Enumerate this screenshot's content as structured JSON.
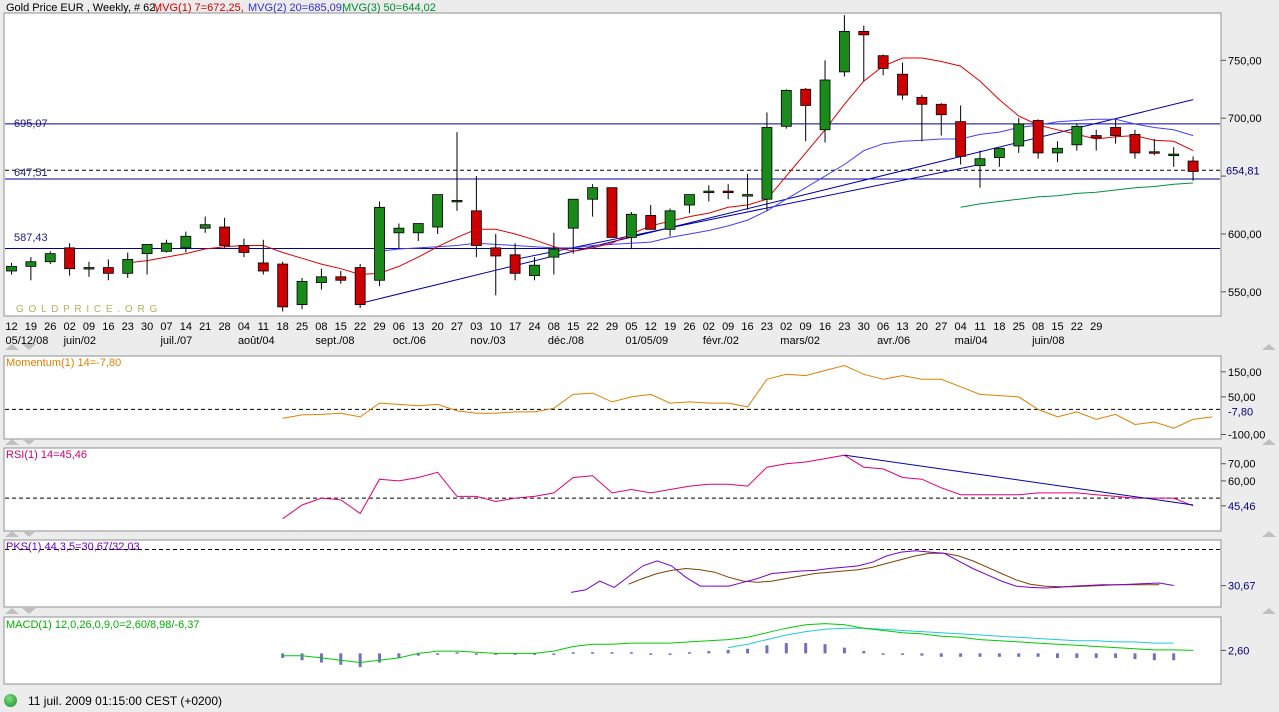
{
  "header": {
    "title": "Gold Price EUR , Weekly, # 62,",
    "mavg1": "MVG(1) 7=672,25,",
    "mavg2": "MVG(2) 20=685,09,",
    "mavg3": "MVG(3) 50=644,02"
  },
  "colors": {
    "up": "#1a8a1a",
    "down": "#cc0000",
    "ma1": "#e00000",
    "ma2": "#4040ff",
    "ma3": "#009040",
    "trend": "#0000b0",
    "momentum": "#e08000",
    "rsi": "#e0007a",
    "pks_k": "#7a00d0",
    "pks_d": "#804000",
    "macd": "#00cc00",
    "signal": "#20c8e0",
    "hist": "#7070c0"
  },
  "watermark": "G O L D P R I C E . O R G",
  "price_labels": {
    "l695": "695,07",
    "l647": "647,51",
    "l587": "587,43",
    "last": "654,81"
  },
  "date_ticks": [
    "12",
    "19",
    "26",
    "02",
    "09",
    "16",
    "23",
    "30",
    "07",
    "14",
    "21",
    "28",
    "04",
    "11",
    "18",
    "25",
    "08",
    "15",
    "22",
    "29",
    "06",
    "13",
    "20",
    "27",
    "03",
    "10",
    "17",
    "24",
    "08",
    "15",
    "22",
    "29",
    "05",
    "12",
    "19",
    "26",
    "02",
    "09",
    "16",
    "23",
    "02",
    "09",
    "16",
    "23",
    "30",
    "06",
    "13",
    "20",
    "27",
    "04",
    "11",
    "18",
    "25",
    "08",
    "15",
    "22",
    "29"
  ],
  "month_labels": [
    {
      "text": "05/12/08",
      "i": 0
    },
    {
      "text": "juin/02",
      "i": 3
    },
    {
      "text": "juil./07",
      "i": 8
    },
    {
      "text": "août/04",
      "i": 12
    },
    {
      "text": "sept./08",
      "i": 16
    },
    {
      "text": "oct./06",
      "i": 20
    },
    {
      "text": "nov./03",
      "i": 24
    },
    {
      "text": "déc./08",
      "i": 28
    },
    {
      "text": "01/05/09",
      "i": 32
    },
    {
      "text": "févr./02",
      "i": 36
    },
    {
      "text": "mars/02",
      "i": 40
    },
    {
      "text": "avr./06",
      "i": 45
    },
    {
      "text": "mai/04",
      "i": 49
    },
    {
      "text": "juin/08",
      "i": 53
    }
  ],
  "panels": {
    "momentum": {
      "label": "Momentum(1) 14=-7,80",
      "last": "-7,80"
    },
    "rsi": {
      "label": "RSI(1) 14=45,46",
      "last": "45,46"
    },
    "pks": {
      "label": "PKS(1) 44,3,5=30,67/32,03",
      "last": "30,67"
    },
    "macd": {
      "label": "MACD(1) 12,0,26,0,9,0=2,60/8,98/-6,37",
      "last": "2,60"
    }
  },
  "footer": {
    "datetime": "11 juil. 2009 01:15:00  CEST (+0200)"
  },
  "chart_data": [
    {
      "type": "candlestick",
      "title": "Gold Price EUR , Weekly, # 62,",
      "ylim": [
        530,
        790
      ],
      "y_ticks": [
        550,
        600,
        650,
        700,
        750
      ],
      "y_tick_labels": [
        "550,00",
        "600,00",
        "",
        "700,00",
        "750,00"
      ],
      "horizontal_lines": [
        695.07,
        647.51,
        587.43
      ],
      "dashed_line": 655,
      "last_value": 654.81,
      "candles": [
        [
          568,
          575,
          565,
          572
        ],
        [
          572,
          580,
          560,
          576
        ],
        [
          576,
          585,
          574,
          583
        ],
        [
          588,
          592,
          564,
          570
        ],
        [
          571,
          576,
          563,
          571
        ],
        [
          571,
          578,
          560,
          566
        ],
        [
          566,
          584,
          562,
          578
        ],
        [
          583,
          590,
          565,
          591
        ],
        [
          585,
          595,
          584,
          592
        ],
        [
          588,
          602,
          584,
          598
        ],
        [
          605,
          615,
          601,
          608
        ],
        [
          606,
          614,
          588,
          590
        ],
        [
          590,
          596,
          580,
          584
        ],
        [
          575,
          595,
          565,
          568
        ],
        [
          574,
          576,
          533,
          537
        ],
        [
          539,
          562,
          535,
          559
        ],
        [
          558,
          570,
          552,
          563
        ],
        [
          563,
          568,
          557,
          560
        ],
        [
          571,
          574,
          536,
          539
        ],
        [
          560,
          628,
          555,
          623
        ],
        [
          601,
          609,
          587,
          605
        ],
        [
          601,
          608,
          594,
          609
        ],
        [
          606,
          634,
          600,
          634
        ],
        [
          629,
          688,
          620,
          629
        ],
        [
          620,
          650,
          580,
          590
        ],
        [
          588,
          600,
          547,
          581
        ],
        [
          582,
          592,
          560,
          566
        ],
        [
          564,
          580,
          560,
          573
        ],
        [
          580,
          601,
          565,
          587
        ],
        [
          605,
          625,
          583,
          630
        ],
        [
          630,
          643,
          615,
          640
        ],
        [
          640,
          635,
          612,
          597
        ],
        [
          597,
          619,
          587,
          617
        ],
        [
          616,
          625,
          610,
          604
        ],
        [
          604,
          622,
          598,
          620
        ],
        [
          625,
          633,
          618,
          634
        ],
        [
          636,
          642,
          628,
          637
        ],
        [
          637,
          643,
          630,
          636
        ],
        [
          634,
          652,
          621,
          634
        ],
        [
          630,
          705,
          620,
          692
        ],
        [
          693,
          725,
          691,
          724
        ],
        [
          725,
          726,
          680,
          711
        ],
        [
          690,
          750,
          679,
          733
        ],
        [
          740,
          789,
          736,
          775
        ],
        [
          775,
          780,
          732,
          772
        ],
        [
          754,
          755,
          737,
          743
        ],
        [
          738,
          748,
          716,
          720
        ],
        [
          718,
          720,
          680,
          712
        ],
        [
          712,
          713,
          685,
          703
        ],
        [
          697,
          711,
          660,
          667
        ],
        [
          659,
          672,
          640,
          665
        ],
        [
          666,
          674,
          658,
          674
        ],
        [
          676,
          700,
          670,
          695
        ],
        [
          698,
          699,
          665,
          670
        ],
        [
          670,
          680,
          662,
          674
        ],
        [
          677,
          695,
          672,
          693
        ],
        [
          685,
          690,
          672,
          683
        ],
        [
          692,
          699,
          678,
          685
        ],
        [
          686,
          690,
          665,
          670
        ],
        [
          671,
          682,
          668,
          670
        ],
        [
          669,
          675,
          658,
          669
        ],
        [
          663,
          667,
          646,
          654
        ]
      ],
      "ma7": [
        null,
        null,
        null,
        null,
        null,
        null,
        575,
        577,
        580,
        583,
        587,
        589,
        590,
        590,
        584,
        579,
        574,
        570,
        565,
        566,
        572,
        580,
        589,
        597,
        604,
        604,
        600,
        595,
        589,
        585,
        588,
        592,
        600,
        607,
        611,
        615,
        618,
        623,
        625,
        630,
        650,
        670,
        690,
        712,
        732,
        745,
        752,
        752,
        749,
        745,
        732,
        716,
        702,
        694,
        690,
        686,
        682,
        684,
        685,
        681,
        680,
        672
      ],
      "ma20": [
        null,
        null,
        null,
        null,
        null,
        null,
        null,
        null,
        null,
        null,
        null,
        null,
        null,
        null,
        null,
        null,
        null,
        null,
        null,
        585,
        587,
        588,
        589,
        590,
        592,
        591,
        590,
        589,
        588,
        588,
        590,
        591,
        592,
        593,
        597,
        600,
        603,
        607,
        612,
        620,
        630,
        640,
        650,
        660,
        672,
        678,
        680,
        681,
        682,
        682,
        686,
        688,
        692,
        694,
        697,
        698,
        699,
        699,
        695,
        692,
        690,
        685
      ],
      "ma50": [
        null,
        null,
        null,
        null,
        null,
        null,
        null,
        null,
        null,
        null,
        null,
        null,
        null,
        null,
        null,
        null,
        null,
        null,
        null,
        null,
        null,
        null,
        null,
        null,
        null,
        null,
        null,
        null,
        null,
        null,
        null,
        null,
        null,
        null,
        null,
        null,
        null,
        null,
        null,
        null,
        null,
        null,
        null,
        null,
        null,
        null,
        null,
        null,
        null,
        623,
        626,
        628,
        630,
        632,
        633,
        635,
        636,
        638,
        640,
        641,
        643,
        644
      ],
      "trendlines": [
        {
          "from": [
            18,
            540
          ],
          "to": [
            61,
            716
          ]
        },
        {
          "from": [
            26,
            578
          ],
          "to": [
            50,
            660
          ]
        }
      ]
    },
    {
      "type": "line",
      "name": "Momentum(1) 14",
      "ylim": [
        -110,
        205
      ],
      "y_ticks": [
        150,
        50,
        -100
      ],
      "y_tick_labels": [
        "150,00",
        "50,00",
        "-100,00"
      ],
      "dashed_line": 0,
      "last_value": -7.8,
      "values": [
        null,
        null,
        null,
        null,
        null,
        null,
        null,
        null,
        null,
        null,
        null,
        null,
        null,
        null,
        -35,
        -22,
        -20,
        -15,
        -30,
        25,
        20,
        15,
        20,
        -5,
        -15,
        -15,
        -10,
        -10,
        5,
        60,
        65,
        30,
        50,
        60,
        25,
        30,
        25,
        25,
        10,
        120,
        140,
        135,
        155,
        175,
        140,
        120,
        135,
        120,
        120,
        90,
        60,
        55,
        50,
        0,
        -30,
        -10,
        -40,
        -20,
        -60,
        -50,
        -75,
        -40,
        -30,
        -20,
        -8
      ],
      "values_note": ""
    },
    {
      "type": "line",
      "name": "RSI(1) 14",
      "ylim": [
        32,
        78
      ],
      "y_ticks": [
        70,
        60,
        45.46
      ],
      "y_tick_labels": [
        "70,00",
        "60,00",
        ""
      ],
      "dashed_line": 50,
      "last_value": 45.46,
      "values": [
        null,
        null,
        null,
        null,
        null,
        null,
        null,
        null,
        null,
        null,
        null,
        null,
        null,
        null,
        38,
        46,
        50,
        49,
        41,
        61,
        60,
        62,
        65,
        51,
        51,
        48,
        50,
        51,
        53,
        62,
        63,
        53,
        55,
        53,
        55,
        57,
        58,
        58,
        57,
        68,
        70,
        71,
        73,
        75,
        68,
        67,
        62,
        61,
        56,
        52,
        52,
        52,
        52,
        53,
        53,
        53,
        52,
        51,
        50,
        50,
        50,
        45.5
      ],
      "trendline": {
        "from": [
          43,
          75
        ],
        "to": [
          61,
          46
        ]
      }
    },
    {
      "type": "line",
      "name": "PKS(1) 44,3,5",
      "ylim": [
        0,
        100
      ],
      "y_ticks": [
        30.67
      ],
      "y_tick_labels": [
        ""
      ],
      "dashed_line": 88,
      "last_value": 30.67,
      "series": [
        {
          "values": [
            null,
            null,
            null,
            null,
            null,
            null,
            null,
            null,
            null,
            null,
            null,
            null,
            null,
            null,
            null,
            null,
            null,
            null,
            null,
            null,
            null,
            null,
            null,
            null,
            null,
            null,
            null,
            null,
            null,
            null,
            null,
            null,
            null,
            null,
            null,
            null,
            null,
            null,
            null,
            20,
            24,
            38,
            28,
            45,
            62,
            70,
            62,
            44,
            30,
            30,
            30,
            36,
            42,
            50,
            52,
            54,
            55,
            58,
            60,
            62,
            68,
            78,
            84,
            86,
            84,
            82,
            70,
            58,
            48,
            38,
            30,
            28,
            27,
            28,
            30,
            31,
            32,
            32,
            33,
            34,
            35,
            31
          ]
        },
        {
          "values": [
            null,
            null,
            null,
            null,
            null,
            null,
            null,
            null,
            null,
            null,
            null,
            null,
            null,
            null,
            null,
            null,
            null,
            null,
            null,
            null,
            null,
            null,
            null,
            null,
            null,
            null,
            null,
            null,
            null,
            null,
            null,
            null,
            null,
            null,
            null,
            null,
            null,
            null,
            null,
            null,
            null,
            null,
            null,
            33,
            42,
            50,
            55,
            58,
            56,
            52,
            44,
            38,
            36,
            38,
            42,
            46,
            50,
            52,
            54,
            56,
            60,
            66,
            72,
            78,
            82,
            82,
            78,
            70,
            60,
            50,
            40,
            33,
            30,
            29,
            29,
            30,
            31,
            32,
            32,
            32,
            32
          ]
        }
      ]
    },
    {
      "type": "line",
      "name": "MACD(1) 12,0,26,0,9,0",
      "ylim": [
        -25,
        30
      ],
      "y_ticks": [
        2.6
      ],
      "y_tick_labels": [
        "2,60"
      ],
      "last_value": 2.6,
      "series": [
        {
          "values": [
            null,
            null,
            null,
            null,
            null,
            null,
            null,
            null,
            null,
            null,
            null,
            null,
            null,
            null,
            -2,
            -2,
            -4,
            -6,
            -8,
            -6,
            -4,
            0,
            2,
            2,
            1,
            0,
            0,
            0,
            2,
            6,
            8,
            8,
            9,
            9,
            9,
            10,
            11,
            12,
            14,
            18,
            22,
            25,
            26,
            25,
            22,
            20,
            18,
            17,
            15,
            14,
            12,
            11,
            10,
            9,
            8,
            7,
            6,
            5,
            4,
            3,
            3,
            2.6
          ]
        },
        {
          "values": [
            null,
            null,
            null,
            null,
            null,
            null,
            null,
            null,
            null,
            null,
            null,
            null,
            null,
            null,
            null,
            null,
            null,
            null,
            null,
            null,
            null,
            null,
            null,
            null,
            null,
            null,
            null,
            null,
            null,
            null,
            null,
            null,
            null,
            null,
            null,
            null,
            null,
            5,
            8,
            12,
            16,
            19,
            21,
            22,
            22,
            21,
            20,
            19,
            18,
            17,
            16,
            15,
            14,
            13,
            12,
            11,
            11,
            10,
            10,
            9,
            9
          ]
        },
        {
          "values": [
            null,
            null,
            null,
            null,
            null,
            null,
            null,
            null,
            null,
            null,
            null,
            null,
            null,
            null,
            -4,
            -6,
            -8,
            -10,
            -12,
            -8,
            -4,
            -2,
            0,
            1,
            0,
            -1,
            -1,
            -1,
            0,
            1,
            1,
            1,
            1,
            0,
            0,
            1,
            2,
            3,
            4,
            7,
            9,
            9,
            8,
            5,
            2,
            0,
            -1,
            -2,
            -3,
            -3,
            -3,
            -3,
            -3,
            -3,
            -4,
            -4,
            -4,
            -4,
            -5,
            -6,
            -6
          ]
        }
      ]
    }
  ]
}
